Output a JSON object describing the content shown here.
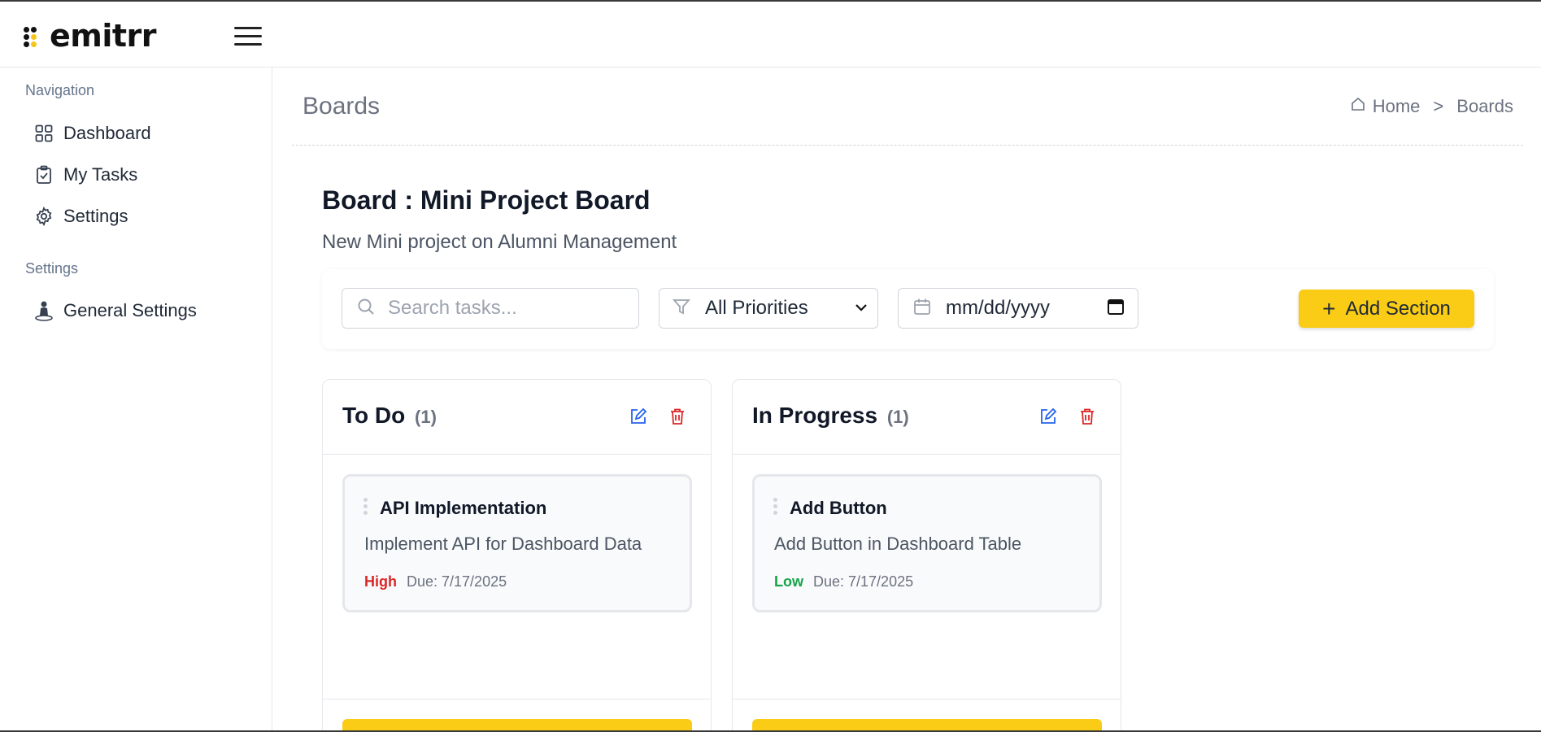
{
  "header": {
    "logo_text": "emitrr"
  },
  "sidebar": {
    "navigation_heading": "Navigation",
    "nav_items": [
      {
        "label": "Dashboard",
        "icon": "grid-icon"
      },
      {
        "label": "My Tasks",
        "icon": "clipboard-check-icon"
      },
      {
        "label": "Settings",
        "icon": "gear-icon"
      }
    ],
    "settings_heading": "Settings",
    "settings_items": [
      {
        "label": "General Settings",
        "icon": "person-pin-icon"
      }
    ]
  },
  "page": {
    "title": "Boards",
    "breadcrumb": {
      "home": "Home",
      "separator": ">",
      "current": "Boards"
    }
  },
  "board": {
    "title": "Board : Mini Project Board",
    "description": "New Mini project on Alumni Management"
  },
  "toolbar": {
    "search_placeholder": "Search tasks...",
    "priority_value": "All Priorities",
    "date_value": "mm/dd/yyyy",
    "add_section_label": "Add Section",
    "add_section_icon": "+"
  },
  "columns": [
    {
      "title": "To Do",
      "count": "(1)",
      "tasks": [
        {
          "title": "API Implementation",
          "description": "Implement API for Dashboard Data",
          "priority": "High",
          "due": "Due: 7/17/2025"
        }
      ]
    },
    {
      "title": "In Progress",
      "count": "(1)",
      "tasks": [
        {
          "title": "Add Button",
          "description": "Add Button in Dashboard Table",
          "priority": "Low",
          "due": "Due: 7/17/2025"
        }
      ]
    }
  ],
  "colors": {
    "accent": "#facc15",
    "high_priority": "#dc2626",
    "low_priority": "#16a34a",
    "edit_icon": "#2563eb",
    "delete_icon": "#dc2626"
  }
}
